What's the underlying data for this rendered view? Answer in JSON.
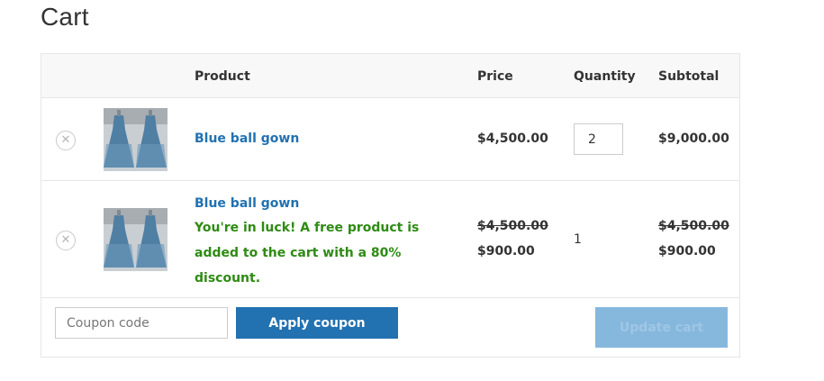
{
  "page": {
    "title": "Cart"
  },
  "table": {
    "headers": {
      "product": "Product",
      "price": "Price",
      "quantity": "Quantity",
      "subtotal": "Subtotal"
    }
  },
  "items": [
    {
      "name": "Blue ball gown",
      "price": "$4,500.00",
      "quantity": "2",
      "subtotal": "$9,000.00",
      "remove_icon": "close-icon"
    },
    {
      "name": "Blue ball gown",
      "promo_message": "You're in luck! A free product is added to the cart with a 80% discount.",
      "price_original": "$4,500.00",
      "price_discounted": "$900.00",
      "quantity": "1",
      "subtotal_original": "$4,500.00",
      "subtotal_discounted": "$900.00",
      "remove_icon": "close-icon"
    }
  ],
  "actions": {
    "coupon_placeholder": "Coupon code",
    "apply_coupon_label": "Apply coupon",
    "update_cart_label": "Update cart"
  },
  "colors": {
    "link": "#2271b1",
    "promo": "#2e8b13",
    "button": "#2271b1",
    "button_disabled": "#86b8de"
  }
}
